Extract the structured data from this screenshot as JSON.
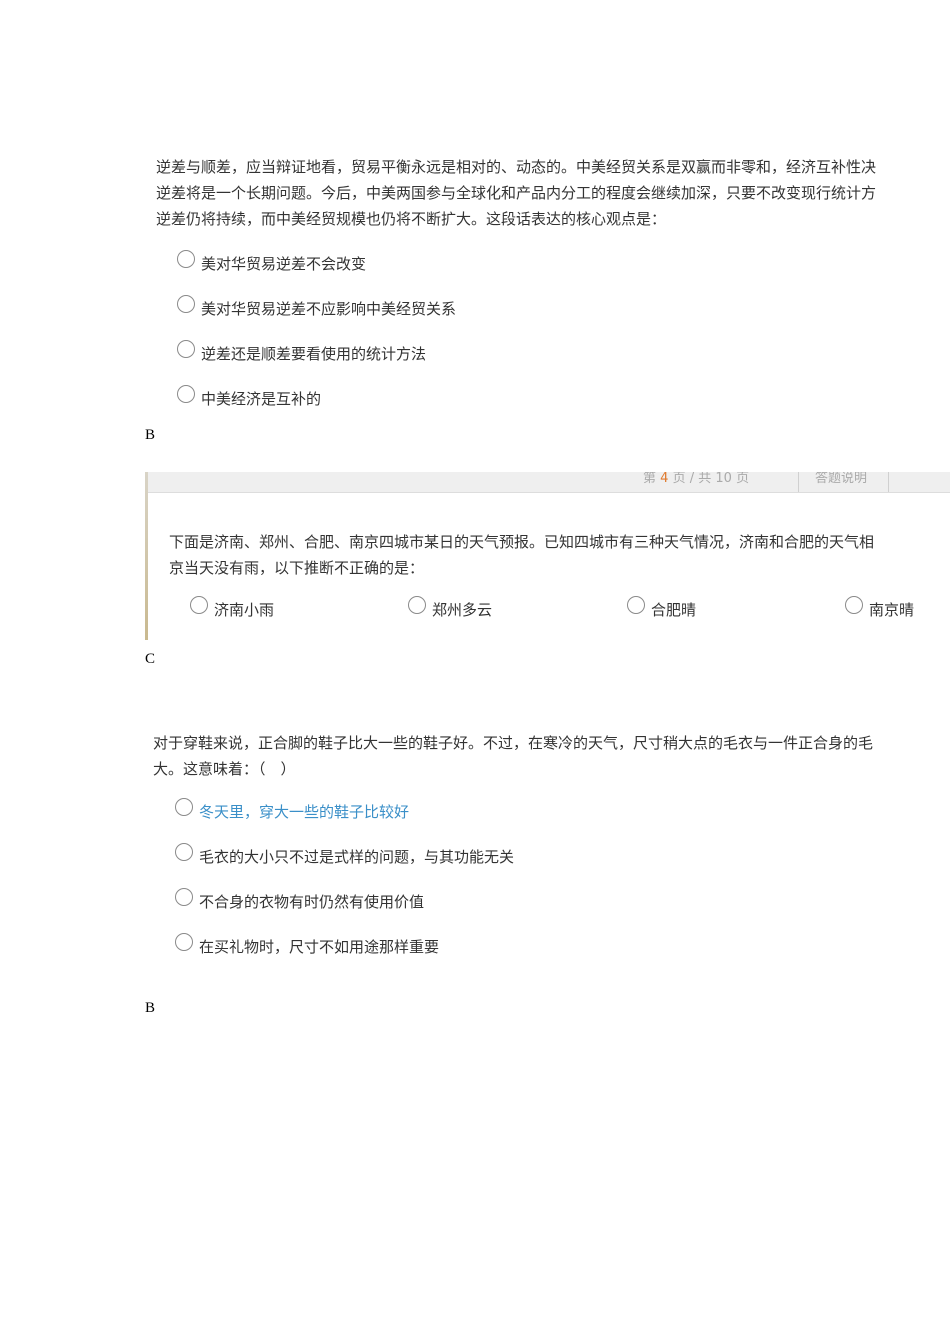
{
  "q1": {
    "lines": [
      "逆差与顺差，应当辩证地看，贸易平衡永远是相对的、动态的。中美经贸关系是双赢而非零和，经济互补性决",
      "逆差将是一个长期问题。今后，中美两国参与全球化和产品内分工的程度会继续加深，只要不改变现行统计方",
      "逆差仍将持续，而中美经贸规模也仍将不断扩大。这段话表达的核心观点是："
    ],
    "options": [
      "美对华贸易逆差不会改变",
      "美对华贸易逆差不应影响中美经贸关系",
      "逆差还是顺差要看使用的统计方法",
      "中美经济是互补的"
    ],
    "answer": "B"
  },
  "q2": {
    "pager": {
      "prefix": "第",
      "current": "4",
      "middle": "页 / 共",
      "total": "10",
      "suffix": "页",
      "help": "答题说明"
    },
    "lines": [
      "下面是济南、郑州、合肥、南京四城市某日的天气预报。已知四城市有三种天气情况，济南和合肥的天气相",
      "京当天没有雨，以下推断不正确的是："
    ],
    "options": [
      "济南小雨",
      "郑州多云",
      "合肥晴",
      "南京晴"
    ],
    "answer": "C"
  },
  "q3": {
    "lines": [
      "对于穿鞋来说，正合脚的鞋子比大一些的鞋子好。不过，在寒冷的天气，尺寸稍大点的毛衣与一件正合身的毛",
      "大。这意味着：（　）"
    ],
    "options": [
      "冬天里，穿大一些的鞋子比较好",
      "毛衣的大小只不过是式样的问题，与其功能无关",
      "不合身的衣物有时仍然有使用价值",
      "在买礼物时，尺寸不如用途那样重要"
    ],
    "answer": "B"
  },
  "colors": {
    "text": "#333333",
    "highlight_option": "#3a8fc8",
    "pager_current": "#e07a2e"
  }
}
